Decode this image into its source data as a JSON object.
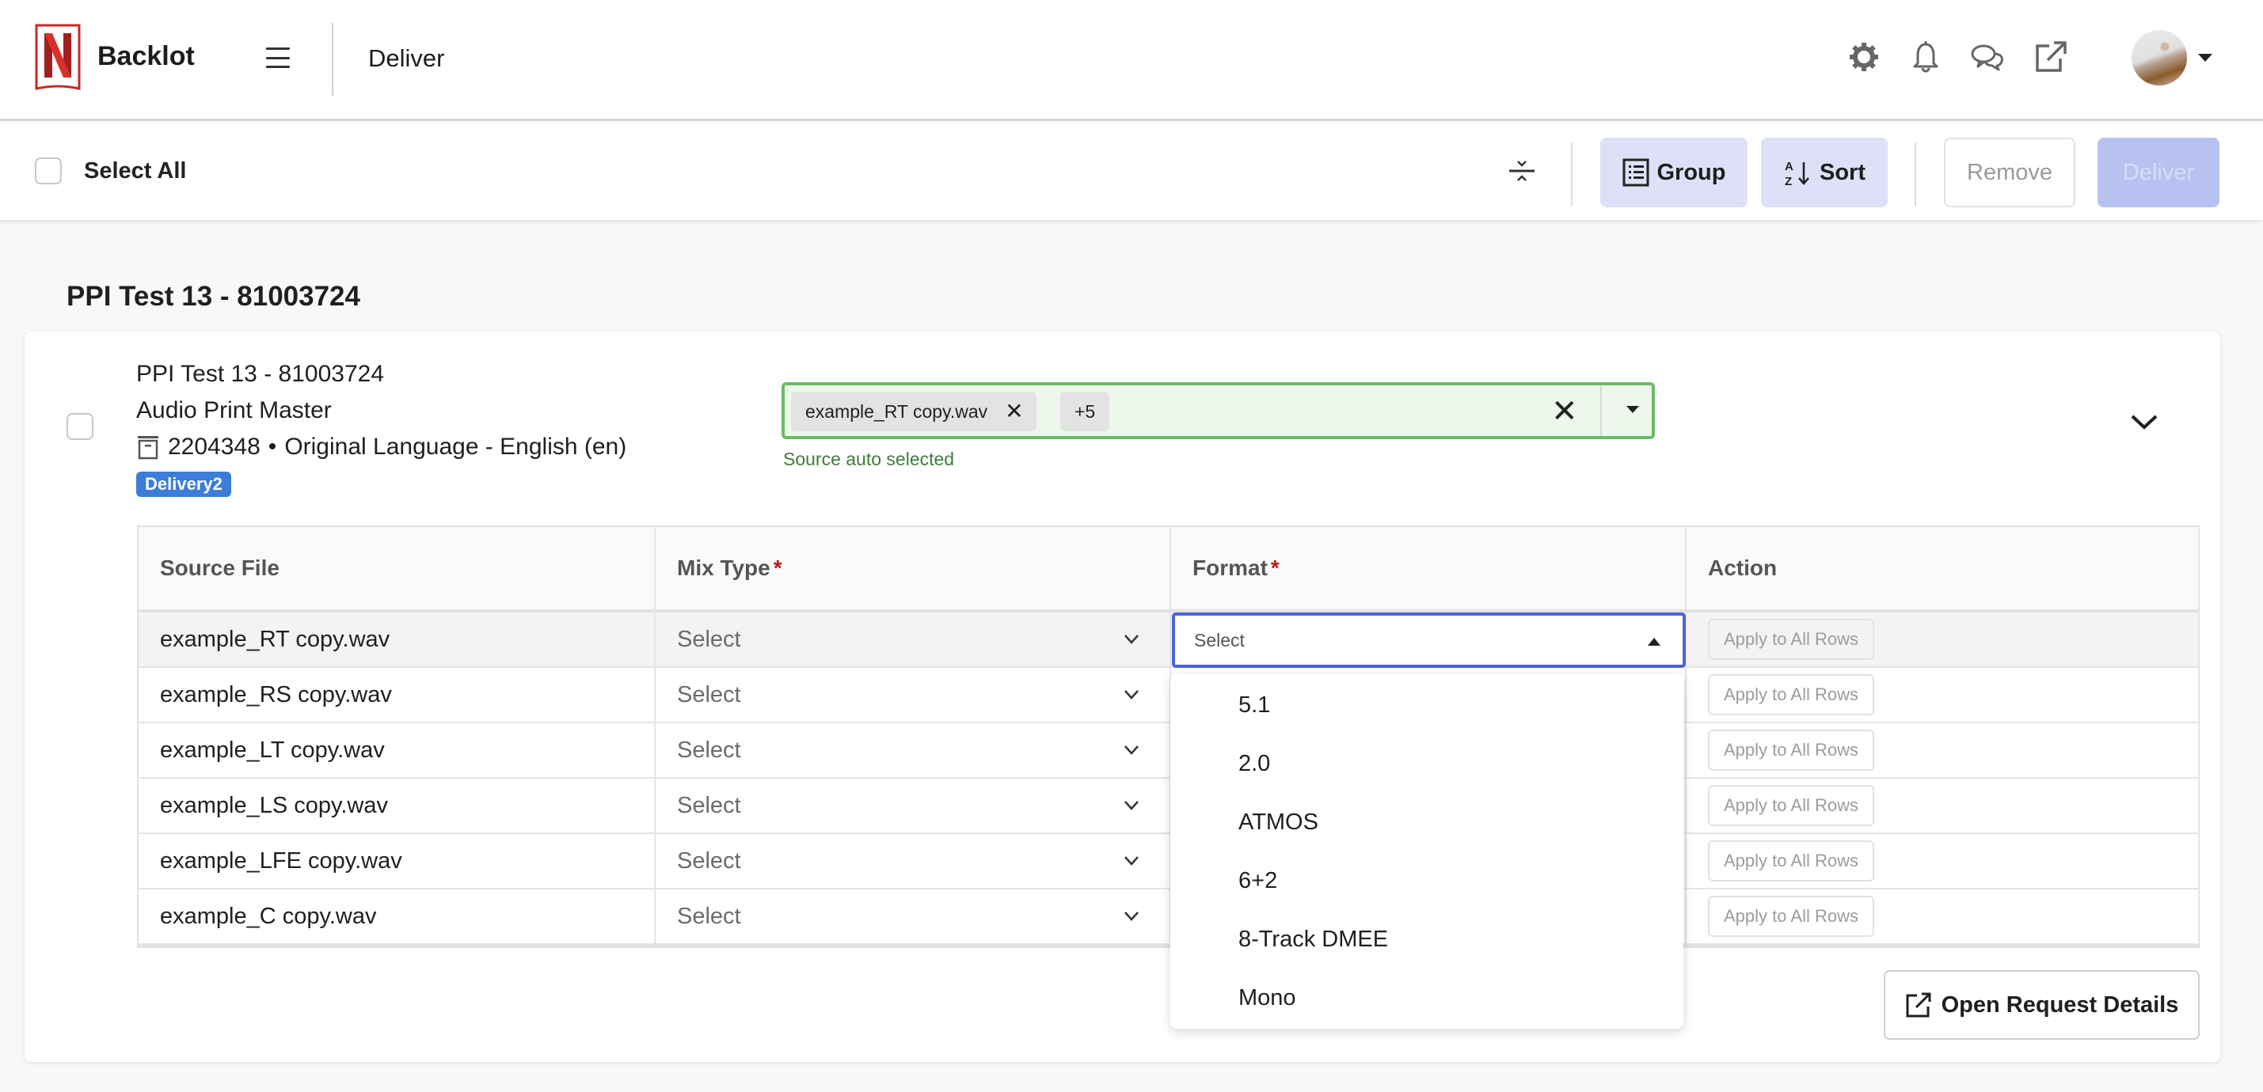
{
  "app": {
    "brand": "Backlot",
    "page": "Deliver",
    "brand_color": "#d32f2f"
  },
  "header": {
    "icons": [
      "gear-icon",
      "bell-icon",
      "chat-icon",
      "external-link-icon"
    ],
    "user_menu_icon": "caret-down-icon"
  },
  "toolbar": {
    "select_all_label": "Select All",
    "group_label": "Group",
    "sort_label": "Sort",
    "remove_label": "Remove",
    "deliver_label": "Deliver"
  },
  "section": {
    "title": "PPI Test 13 - 81003724"
  },
  "item": {
    "title": "PPI Test 13 - 81003724",
    "subtitle": "Audio Print Master",
    "id": "2204348",
    "separator": "•",
    "language": "Original Language - English (en)",
    "badge": "Delivery2",
    "source": {
      "chip_label": "example_RT copy.wav",
      "more_label": "+5",
      "hint": "Source auto selected"
    }
  },
  "table": {
    "headers": {
      "source_file": "Source File",
      "mix_type": "Mix Type",
      "format": "Format",
      "action": "Action",
      "required_marker": "*"
    },
    "rows": [
      {
        "file": "example_RT copy.wav",
        "mix": "Select",
        "format": "Select",
        "action": "Apply to All Rows"
      },
      {
        "file": "example_RS copy.wav",
        "mix": "Select",
        "format": "",
        "action": "Apply to All Rows"
      },
      {
        "file": "example_LT copy.wav",
        "mix": "Select",
        "format": "",
        "action": "Apply to All Rows"
      },
      {
        "file": "example_LS copy.wav",
        "mix": "Select",
        "format": "",
        "action": "Apply to All Rows"
      },
      {
        "file": "example_LFE copy.wav",
        "mix": "Select",
        "format": "",
        "action": "Apply to All Rows"
      },
      {
        "file": "example_C copy.wav",
        "mix": "Select",
        "format": "",
        "action": "Apply to All Rows"
      }
    ]
  },
  "format_dropdown": {
    "options": [
      "5.1",
      "2.0",
      "ATMOS",
      "6+2",
      "8-Track DMEE",
      "Mono"
    ]
  },
  "footer": {
    "open_details_label": "Open Request Details"
  }
}
